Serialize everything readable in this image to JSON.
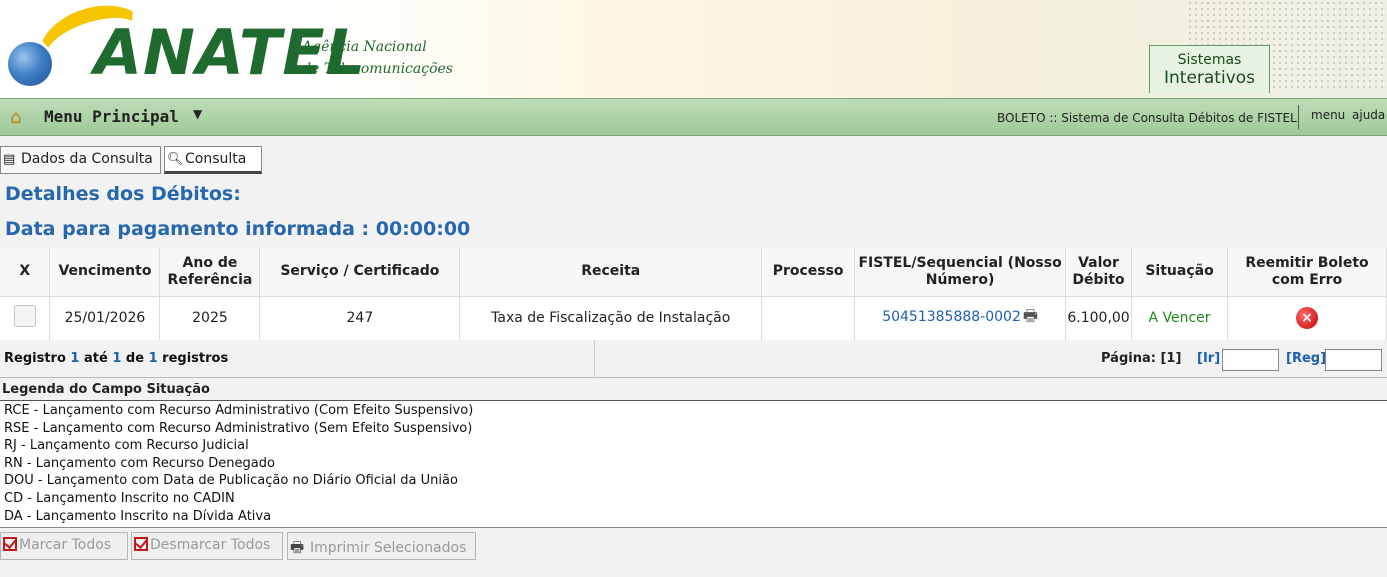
{
  "header": {
    "logo_text": "ANATEL",
    "logo_sub1": "Agência Nacional",
    "logo_sub2": "de Telecomunicações",
    "systems_tab_line1": "Sistemas",
    "systems_tab_line2": "Interativos"
  },
  "menubar": {
    "home_icon": "home-icon",
    "title": "Menu Principal",
    "system_name": "BOLETO :: Sistema de Consulta Débitos de FISTEL",
    "links": [
      "menu",
      "ajuda"
    ]
  },
  "tabs": [
    {
      "label": "Dados da Consulta",
      "icon": "form-icon"
    },
    {
      "label": "Consulta",
      "icon": "magnifier-icon"
    }
  ],
  "headings": {
    "details": "Detalhes dos Débitos:",
    "payment_date": "Data para pagamento informada : 00:00:00"
  },
  "table": {
    "columns": [
      "X",
      "Vencimento",
      "Ano de Referência",
      "Serviço / Certificado",
      "Receita",
      "Processo",
      "FISTEL/Sequencial (Nosso Número)",
      "Valor Débito",
      "Situação",
      "Reemitir Boleto com Erro"
    ],
    "rows": [
      {
        "vencimento": "25/01/2026",
        "ano_referencia": "2025",
        "servico": "247",
        "receita": "Taxa de Fiscalização de Instalação",
        "processo": "",
        "fistel": "50451385888-0002",
        "valor": "6.100,00",
        "situacao": "A Vencer"
      }
    ]
  },
  "pager": {
    "prefix": "Registro",
    "from": "1",
    "mid": "até",
    "to": "1",
    "of": "de",
    "total": "1",
    "suffix": "registros",
    "page_label": "Página:",
    "page_value": "[1]",
    "go_label": "[Ir]",
    "reg_label": "[Reg]"
  },
  "legend": {
    "title": "Legenda do Campo Situação",
    "items": [
      "RCE - Lançamento com Recurso Administrativo (Com Efeito Suspensivo)",
      "RSE - Lançamento com Recurso Administrativo (Sem Efeito Suspensivo)",
      "RJ - Lançamento com Recurso Judicial",
      "RN - Lançamento com Recurso Denegado",
      "DOU - Lançamento com Data de Publicação no Diário Oficial da União",
      "CD - Lançamento Inscrito no CADIN",
      "DA - Lançamento Inscrito na Dívida Ativa"
    ]
  },
  "actions": {
    "mark_all": "Marcar Todos",
    "unmark_all": "Desmarcar Todos",
    "print_selected": "Imprimir Selecionados"
  },
  "colors": {
    "heading_blue": "#2667ad",
    "menubar_green": "#9ec997",
    "status_green": "#1c8a1c",
    "error_red": "#c40000"
  }
}
